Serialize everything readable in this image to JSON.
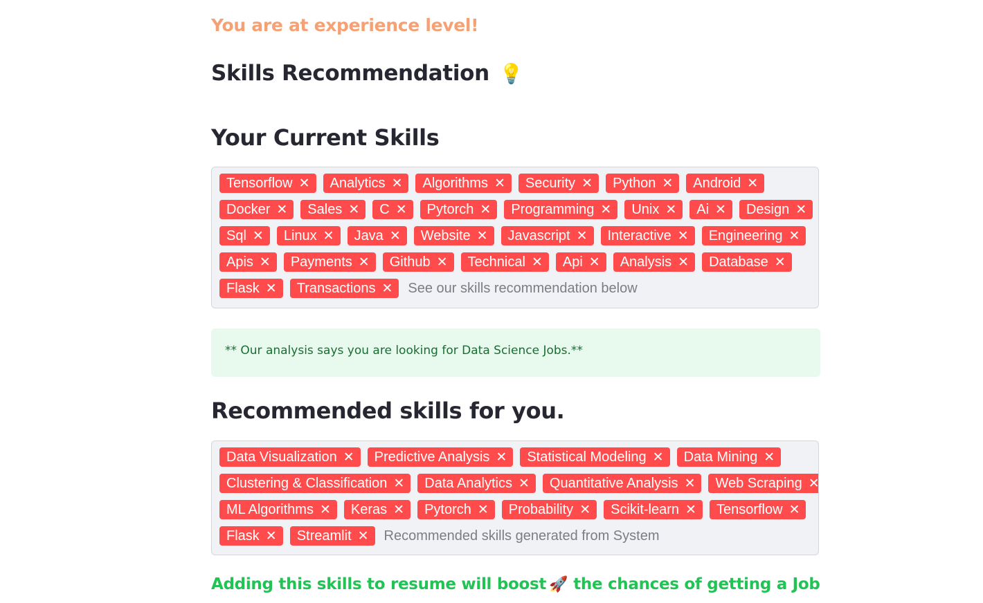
{
  "level_message": "You are at experience level!",
  "skills_heading": "Skills Recommendation",
  "skills_heading_emoji": "💡",
  "current_heading": "Your Current Skills",
  "current_skills": [
    "Tensorflow",
    "Analytics",
    "Algorithms",
    "Security",
    "Python",
    "Android",
    "Docker",
    "Sales",
    "C",
    "Pytorch",
    "Programming",
    "Unix",
    "Ai",
    "Design",
    "Sql",
    "Linux",
    "Java",
    "Website",
    "Javascript",
    "Interactive",
    "Engineering",
    "Apis",
    "Payments",
    "Github",
    "Technical",
    "Api",
    "Analysis",
    "Database",
    "Flask",
    "Transactions"
  ],
  "current_placeholder": "See our skills recommendation below",
  "info_message": "** Our analysis says you are looking for Data Science Jobs.**",
  "recommended_heading": "Recommended skills for you.",
  "recommended_skills": [
    "Data Visualization",
    "Predictive Analysis",
    "Statistical Modeling",
    "Data Mining",
    "Clustering & Classification",
    "Data Analytics",
    "Quantitative Analysis",
    "Web Scraping",
    "ML Algorithms",
    "Keras",
    "Pytorch",
    "Probability",
    "Scikit-learn",
    "Tensorflow",
    "Flask",
    "Streamlit"
  ],
  "recommended_placeholder": "Recommended skills generated from System",
  "boost_before": "Adding this skills to resume will boost",
  "boost_emoji": "🚀",
  "boost_after": "the chances of getting a Job",
  "remove_glyph": "✕",
  "colors": {
    "tag_bg": "#ff4b4b",
    "level_text": "#f4a275",
    "info_bg": "#e8f9ee",
    "info_text": "#1a6d33",
    "boost_text": "#21c354"
  }
}
